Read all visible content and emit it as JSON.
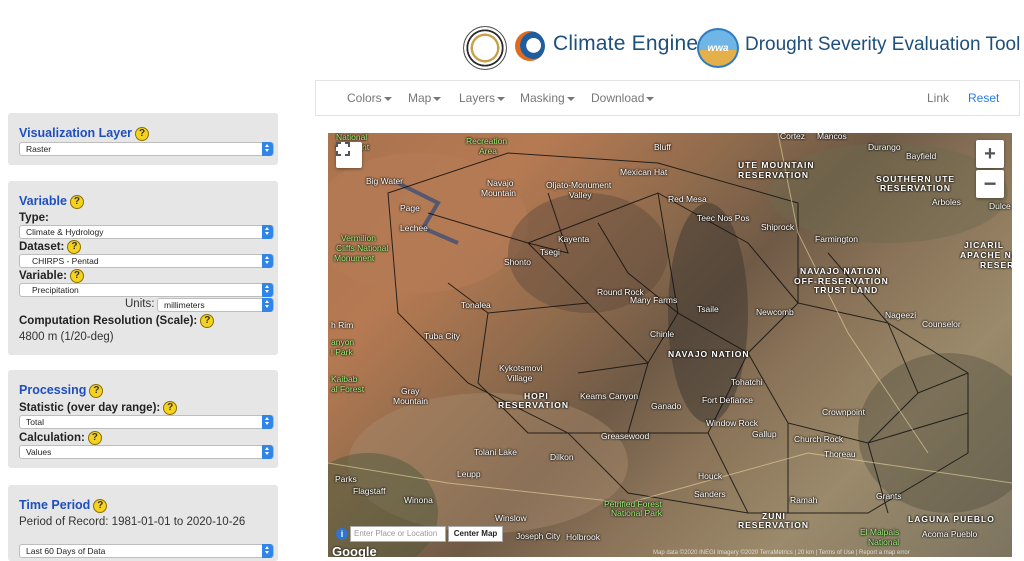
{
  "header": {
    "climate_engine": "Climate Engine",
    "dset": "Drought Severity Evaluation Tool",
    "wwa_logo_text": "wwa"
  },
  "navbar": {
    "items": [
      "Colors",
      "Map",
      "Layers",
      "Masking",
      "Download"
    ],
    "link": "Link",
    "reset": "Reset"
  },
  "visualization": {
    "title": "Visualization Layer",
    "select": "Raster"
  },
  "variable": {
    "title": "Variable",
    "type_label": "Type:",
    "type_value": "Climate & Hydrology",
    "dataset_label": "Dataset:",
    "dataset_value": "CHIRPS - Pentad",
    "variable_label": "Variable:",
    "variable_value": "Precipitation",
    "units_label": "Units:",
    "units_value": "millimeters",
    "resolution_label": "Computation Resolution (Scale):",
    "resolution_value": "4800 m (1/20-deg)"
  },
  "processing": {
    "title": "Processing",
    "statistic_label": "Statistic (over day range):",
    "statistic_value": "Total",
    "calculation_label": "Calculation:",
    "calculation_value": "Values"
  },
  "time_period": {
    "title": "Time Period",
    "record": "Period of Record: 1981-01-01 to 2020-10-26",
    "select": "Last 60 Days of Data"
  },
  "map": {
    "search_placeholder": "Enter Place or Location",
    "center_button": "Center Map",
    "google": "Google",
    "attribution": "Map data ©2020 INEGI Imagery ©2020 TerraMetrics | 20 km | Terms of Use | Report a map error",
    "labels": [
      {
        "text": "National",
        "cls": "green"
      },
      {
        "text": "onument",
        "cls": "green"
      },
      {
        "text": "Recreation",
        "cls": "green"
      },
      {
        "text": "Area",
        "cls": "green"
      },
      {
        "text": "Bluff",
        "cls": ""
      },
      {
        "text": "Cortez",
        "cls": ""
      },
      {
        "text": "Mancos",
        "cls": ""
      },
      {
        "text": "Durango",
        "cls": ""
      },
      {
        "text": "Bayfield",
        "cls": ""
      },
      {
        "text": "UTE MOUNTAIN",
        "cls": "big"
      },
      {
        "text": "RESERVATION",
        "cls": "big"
      },
      {
        "text": "SOUTHERN UTE",
        "cls": "big"
      },
      {
        "text": "RESERVATION",
        "cls": "big"
      },
      {
        "text": "Big Water",
        "cls": ""
      },
      {
        "text": "Navajo",
        "cls": ""
      },
      {
        "text": "Mountain",
        "cls": ""
      },
      {
        "text": "Oljato-Monument",
        "cls": ""
      },
      {
        "text": "Valley",
        "cls": ""
      },
      {
        "text": "Mexican Hat",
        "cls": ""
      },
      {
        "text": "Red Mesa",
        "cls": ""
      },
      {
        "text": "Arboles",
        "cls": ""
      },
      {
        "text": "Dulce",
        "cls": ""
      },
      {
        "text": "Page",
        "cls": ""
      },
      {
        "text": "Teec Nos Pos",
        "cls": ""
      },
      {
        "text": "Lechee",
        "cls": ""
      },
      {
        "text": "Shiprock",
        "cls": ""
      },
      {
        "text": "Vermilion",
        "cls": "green"
      },
      {
        "text": "Cliffs National",
        "cls": "green"
      },
      {
        "text": "Monument",
        "cls": "green"
      },
      {
        "text": "Kayenta",
        "cls": ""
      },
      {
        "text": "Farmington",
        "cls": ""
      },
      {
        "text": "JICARIL",
        "cls": "big"
      },
      {
        "text": "APACHE NA",
        "cls": "big"
      },
      {
        "text": "RESERVA",
        "cls": "big"
      },
      {
        "text": "Tsegi",
        "cls": ""
      },
      {
        "text": "Shonto",
        "cls": ""
      },
      {
        "text": "NAVAJO NATION",
        "cls": "big"
      },
      {
        "text": "OFF-RESERVATION",
        "cls": "big"
      },
      {
        "text": "TRUST LAND",
        "cls": "big"
      },
      {
        "text": "Round Rock",
        "cls": ""
      },
      {
        "text": "Many Farms",
        "cls": ""
      },
      {
        "text": "Tonalea",
        "cls": ""
      },
      {
        "text": "Tsaile",
        "cls": ""
      },
      {
        "text": "Nageezi",
        "cls": ""
      },
      {
        "text": "Newcomb",
        "cls": ""
      },
      {
        "text": "Counselor",
        "cls": ""
      },
      {
        "text": "h Rim",
        "cls": ""
      },
      {
        "text": "Tuba City",
        "cls": ""
      },
      {
        "text": "Chinle",
        "cls": ""
      },
      {
        "text": "anyon",
        "cls": "green"
      },
      {
        "text": "l Park",
        "cls": "green"
      },
      {
        "text": "NAVAJO NATION",
        "cls": "big"
      },
      {
        "text": "Kykotsmovi",
        "cls": ""
      },
      {
        "text": "Village",
        "cls": ""
      },
      {
        "text": "Kaibab",
        "cls": "green"
      },
      {
        "text": "al Forest",
        "cls": "green"
      },
      {
        "text": "Gray",
        "cls": ""
      },
      {
        "text": "Mountain",
        "cls": ""
      },
      {
        "text": "HOPI",
        "cls": "big"
      },
      {
        "text": "RESERVATION",
        "cls": "big"
      },
      {
        "text": "Keams Canyon",
        "cls": ""
      },
      {
        "text": "Tohatchi",
        "cls": ""
      },
      {
        "text": "Ganado",
        "cls": ""
      },
      {
        "text": "Fort Defiance",
        "cls": ""
      },
      {
        "text": "Crownpoint",
        "cls": ""
      },
      {
        "text": "Window Rock",
        "cls": ""
      },
      {
        "text": "Gallup",
        "cls": ""
      },
      {
        "text": "Church Rock",
        "cls": ""
      },
      {
        "text": "Greasewood",
        "cls": ""
      },
      {
        "text": "Tolani Lake",
        "cls": ""
      },
      {
        "text": "Dilkon",
        "cls": ""
      },
      {
        "text": "Thoreau",
        "cls": ""
      },
      {
        "text": "Parks",
        "cls": ""
      },
      {
        "text": "Leupp",
        "cls": ""
      },
      {
        "text": "Houck",
        "cls": ""
      },
      {
        "text": "Flagstaff",
        "cls": ""
      },
      {
        "text": "Sanders",
        "cls": ""
      },
      {
        "text": "Grants",
        "cls": ""
      },
      {
        "text": "Winona",
        "cls": ""
      },
      {
        "text": "Ramah",
        "cls": ""
      },
      {
        "text": "Petrified Forest",
        "cls": "green"
      },
      {
        "text": "National Park",
        "cls": "green"
      },
      {
        "text": "Winslow",
        "cls": ""
      },
      {
        "text": "ZUNI",
        "cls": "big"
      },
      {
        "text": "RESERVATION",
        "cls": "big"
      },
      {
        "text": "El Malpais",
        "cls": "green"
      },
      {
        "text": "National",
        "cls": "green"
      },
      {
        "text": "LAGUNA PUEBLO",
        "cls": "big"
      },
      {
        "text": "Acoma Pueblo",
        "cls": ""
      },
      {
        "text": "Joseph City",
        "cls": ""
      },
      {
        "text": "Holbrook",
        "cls": ""
      }
    ]
  }
}
